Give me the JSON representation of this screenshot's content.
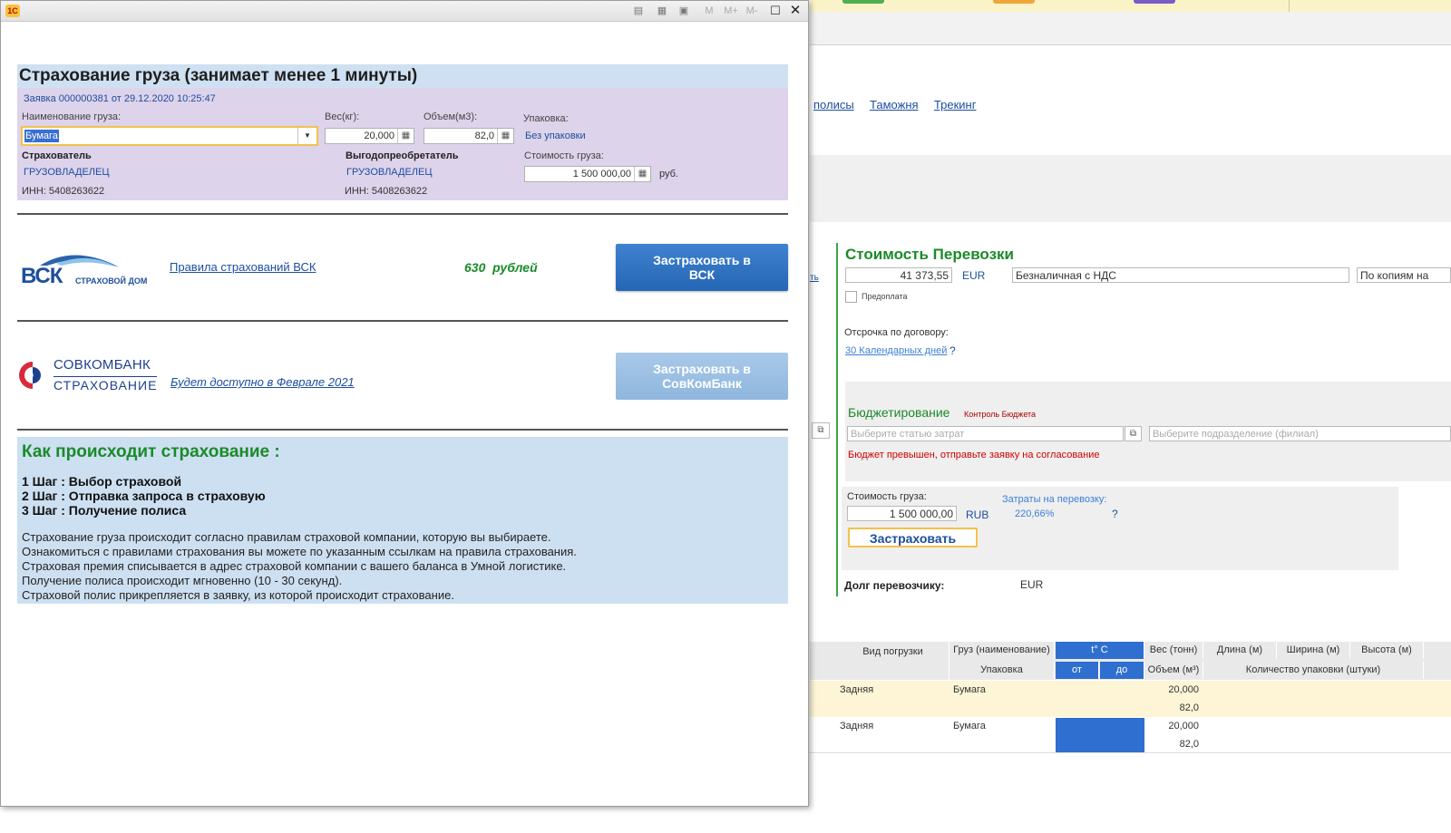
{
  "window": {
    "toolbar_icons": [
      "print-preview-icon",
      "calculator-icon",
      "calendar-icon"
    ],
    "memory_buttons": [
      "M",
      "M+",
      "M-"
    ]
  },
  "insurance": {
    "title": "Страхование груза (занимает менее 1 минуты)",
    "order_ref": "Заявка 000000381 от 29.12.2020 10:25:47",
    "cargo_name_label": "Наименование груза:",
    "cargo_name_value": "Бумага",
    "weight_label": "Вес(кг):",
    "weight_value": "20,000",
    "volume_label": "Объем(м3):",
    "volume_value": "82,0",
    "package_label": "Упаковка:",
    "package_value": "Без упаковки",
    "insurer_label": "Страхователь",
    "insurer_name": "ГРУЗОВЛАДЕЛЕЦ",
    "insurer_inn": "ИНН: 5408263622",
    "beneficiary_label": "Выгодопреобретатель",
    "beneficiary_name": "ГРУЗОВЛАДЕЛЕЦ",
    "beneficiary_inn": "ИНН: 5408263622",
    "cargo_value_label": "Стоимость груза:",
    "cargo_value": "1 500 000,00",
    "currency": "руб."
  },
  "offers": [
    {
      "logo_main": "ВСК",
      "logo_sub": "СТРАХОВОЙ ДОМ",
      "link": "Правила страхований ВСК",
      "price": "630  рублей",
      "button": "Застраховать в ВСК"
    },
    {
      "logo_main": "СОВКОМБАНК",
      "logo_sub": "СТРАХОВАНИЕ",
      "link": "Будет доступно в Феврале 2021",
      "button": "Застраховать в СовКомБанк"
    }
  ],
  "howto": {
    "title": "Как происходит страхование :",
    "steps": [
      "1 Шаг : Выбор страховой",
      "2 Шаг : Отправка запроса в страховую",
      "3 Шаг : Получение полиса"
    ],
    "paragraphs": [
      "Страхование груза происходит согласно правилам страховой компании, которую вы выбираете.",
      "Ознакомиться с правилами страхования вы можете по указанным ссылкам на правила страхования.",
      "Страховая премия списывается в адрес страховой компании с вашего баланса в Умной логистике.",
      "Получение полиса происходит мгновенно (10 - 30 секунд).",
      "Страховой полис прикрепляется в заявку, из которой происходит страхование."
    ]
  },
  "background": {
    "links": [
      "полисы",
      "Таможня",
      "Трекинг"
    ],
    "cut_link": "ть",
    "cost_title": "Стоимость Перевозки",
    "cost_value": "41 373,55",
    "cost_currency": "EUR",
    "payment_type": "Безналичная с НДС",
    "copies": "По копиям на",
    "prepay_label": "Предоплата",
    "deferral_label": "Отсрочка по договору:",
    "deferral_value": "30 Календарных дней",
    "help": "?",
    "budget_title": "Бюджетирование",
    "budget_control": "Контроль Бюджета",
    "budget_item_placeholder": "Выберите статью затрат",
    "budget_dept_placeholder": "Выберите подразделение (филиал)",
    "budget_warning": "Бюджет превышен, отправьте заявку на согласование",
    "cargo_cost_label": "Стоимость груза:",
    "cargo_cost_value": "1 500 000,00",
    "cargo_cost_currency": "RUB",
    "transport_cost_label": "Затраты на перевозку:",
    "transport_cost_percent": "220,66%",
    "insure_button": "Застраховать",
    "debt_label": "Долг перевозчику:",
    "debt_currency": "EUR",
    "table": {
      "headers_top": [
        "Вид погрузки",
        "Груз (наименование)",
        "t° C",
        "Вес (тонн)",
        "Длина (м)",
        "Ширина (м)",
        "Высота (м)"
      ],
      "headers_bottom": [
        "Упаковка",
        "от",
        "до",
        "Объем (м³)",
        "Количество упаковки (штуки)"
      ],
      "rows": [
        {
          "loading": "Задняя",
          "cargo": "Бумага",
          "weight": "20,000",
          "volume": "82,0"
        },
        {
          "loading": "Задняя",
          "cargo": "Бумага",
          "weight": "20,000",
          "volume": "82,0"
        }
      ]
    }
  }
}
